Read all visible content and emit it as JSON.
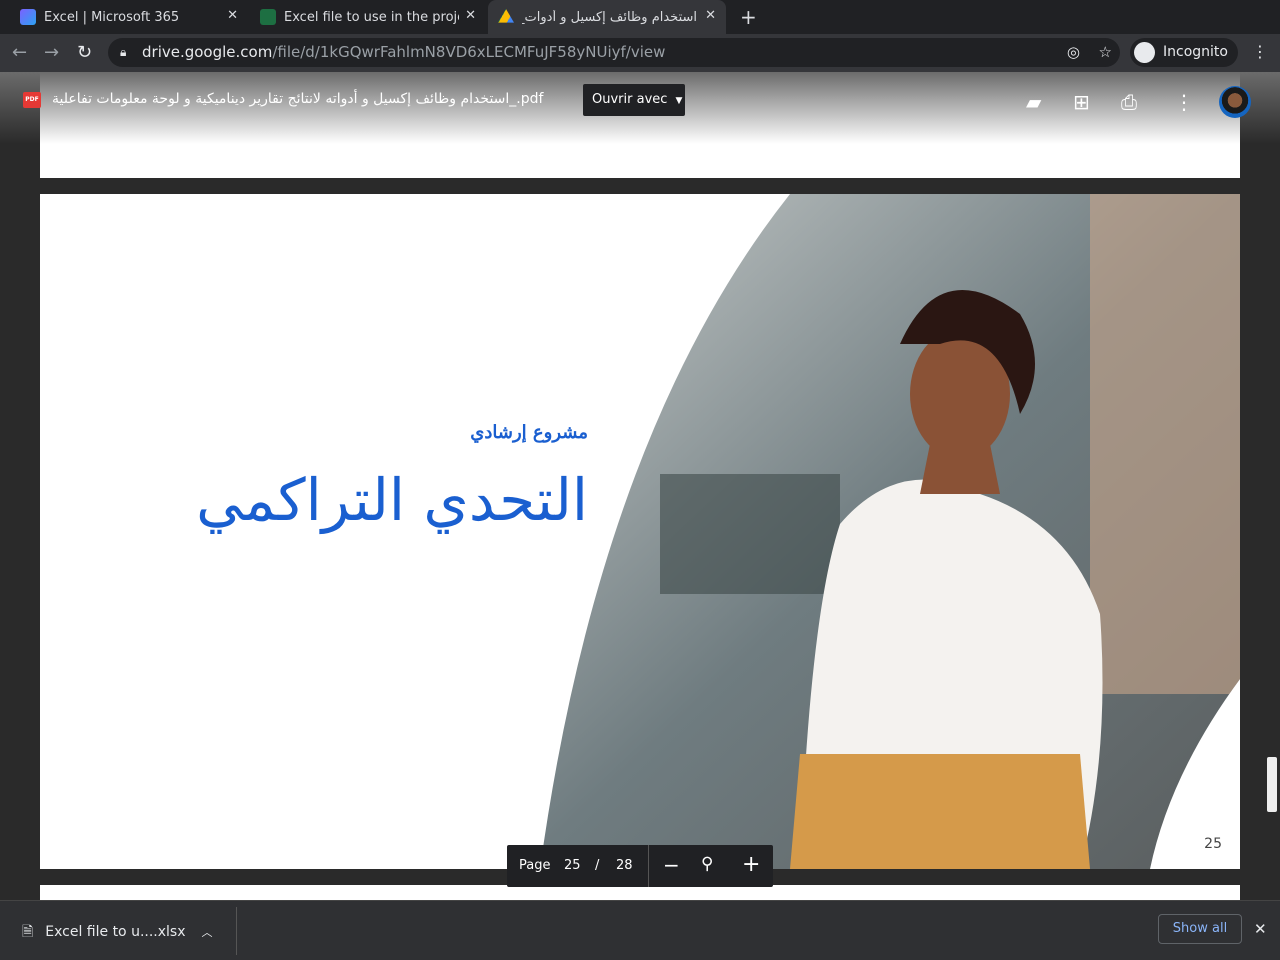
{
  "tabs": [
    {
      "title": "Excel | Microsoft 365",
      "icon": "microsoft365-icon"
    },
    {
      "title": "Excel file to use in the project",
      "icon": "excel-icon"
    },
    {
      "title": "استخدام وظائف إكسيل و أدوات_",
      "icon": "google-drive-icon",
      "active": true
    }
  ],
  "address": {
    "host": "drive.google.com",
    "path": "/file/d/1kGQwrFahlmN8VD6xLECMFuJF58yNUiyf/view"
  },
  "incognito_label": "Incognito",
  "viewer": {
    "filename": "استخدام وظائف إكسيل و أدواته لانتائج تقارير ديناميكية و لوحة معلومات تفاعلية_.pdf",
    "pdf_badge": "PDF",
    "open_with": "Ouvrir avec"
  },
  "slide": {
    "subtitle": "مشروع إرشادي",
    "title": "التحدي التراكمي",
    "page_number": "25"
  },
  "pager": {
    "label": "Page",
    "current": "25",
    "sep": "/",
    "total": "28"
  },
  "downloads": {
    "file": "Excel file to u....xlsx",
    "show_all": "Show all"
  }
}
